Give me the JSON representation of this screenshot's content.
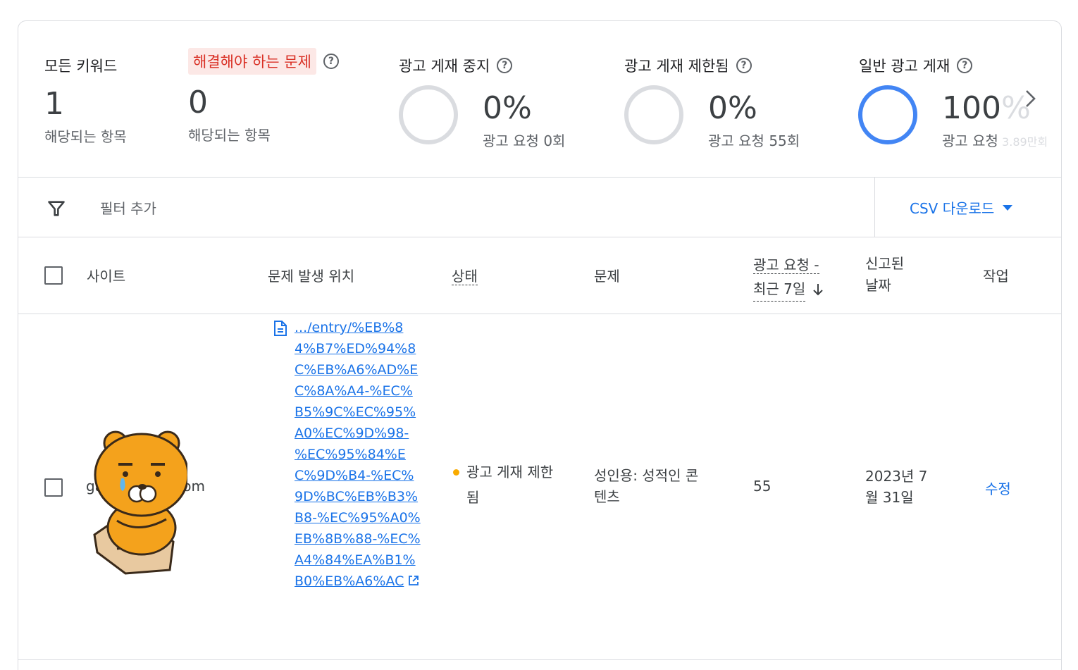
{
  "summary": {
    "all_keywords": {
      "label": "모든 키워드",
      "value": "1",
      "sub": "해당되는 항목"
    },
    "issues": {
      "label": "해결해야 하는 문제",
      "value": "0",
      "sub": "해당되는 항목"
    },
    "stopped": {
      "label": "광고 게재 중지",
      "value": "0%",
      "sub": "광고 요청 0회",
      "fraction": 0
    },
    "limited": {
      "label": "광고 게재 제한됨",
      "value": "0%",
      "sub": "광고 요청 55회",
      "fraction": 0
    },
    "normal": {
      "label": "일반 광고 게재",
      "value_main": "100",
      "value_fade": "%",
      "sub_main": "광고 요청",
      "sub_fade": " 3.89만회",
      "fraction": 1.0
    }
  },
  "filter": {
    "placeholder": "필터 추가",
    "csv_label": "CSV 다운로드"
  },
  "table": {
    "headers": {
      "site": "사이트",
      "location": "문제 발생 위치",
      "status": "상태",
      "issue": "문제",
      "requests_line1": "광고 요청 -",
      "requests_line2": "최근 7일",
      "reported_line1": "신고된",
      "reported_line2": "날짜",
      "action": "작업"
    },
    "rows": [
      {
        "site_prefix": "ga",
        "site_suffix": "y.com",
        "location_url": ".../entry/%EB%84%B7%ED%94%8C%EB%A6%AD%EC%8A%A4-%EC%B5%9C%EC%95%A0%EC%9D%98-%EC%95%84%EC%9D%B4-%EC%9D%BC%EB%B3%B8-%EC%95%A0%EB%8B%88-%EC%A4%84%EA%B1%B0%EB%A6%AC",
        "status_line1": "광고 게재 제한",
        "status_line2": "됨",
        "issue_line1": "성인용: 성적인 콘",
        "issue_line2": "텐츠",
        "requests": "55",
        "reported_line1": "2023년 7",
        "reported_line2": "월 31일",
        "action": "수정"
      }
    ]
  },
  "colors": {
    "accent": "#1a73e8",
    "error": "#d93025",
    "status_warning": "#f9ab00",
    "donut_full": "#4285f4",
    "donut_empty": "#dadce0"
  },
  "icons": [
    "help-icon",
    "filter-icon",
    "chevron-right-icon",
    "document-icon",
    "external-link-icon",
    "dropdown-caret-icon",
    "arrow-down-icon"
  ]
}
